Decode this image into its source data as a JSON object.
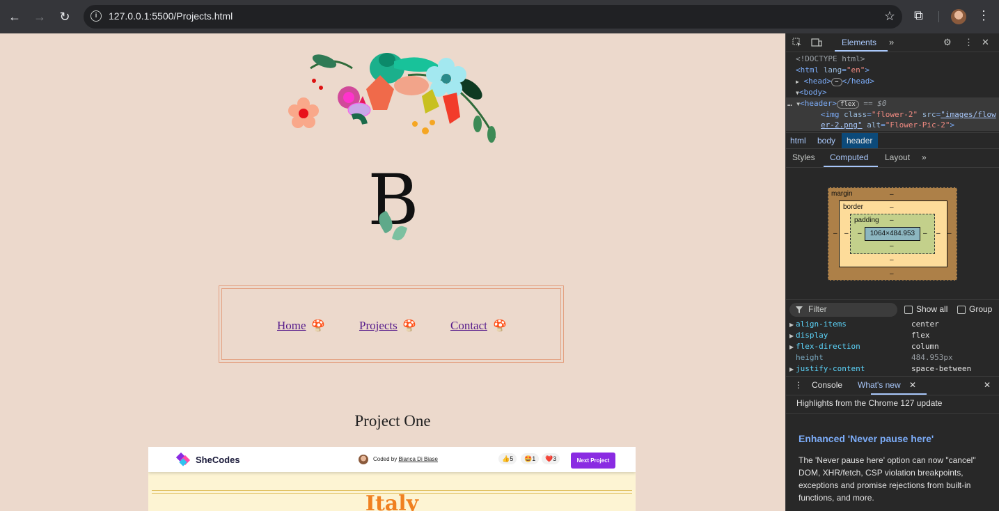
{
  "browser": {
    "url": "127.0.0.1:5500/Projects.html",
    "back_icon": "←",
    "forward_icon": "→",
    "reload_icon": "↻",
    "star_icon": "☆",
    "extensions_icon": "⧉",
    "menu_icon": "⋮"
  },
  "page": {
    "logo_letter": "B",
    "nav": [
      {
        "label": "Home",
        "emoji": "🍄"
      },
      {
        "label": "Projects",
        "emoji": "🍄"
      },
      {
        "label": "Contact",
        "emoji": "🍄"
      }
    ],
    "project_title": "Project One",
    "shecodes": {
      "brand": "SheCodes",
      "coded_by_prefix": "Coded by",
      "coder_name": "Bianca Di Biase",
      "reactions": [
        {
          "emoji": "👍",
          "count": "5"
        },
        {
          "emoji": "🤩",
          "count": "1"
        },
        {
          "emoji": "❤️",
          "count": "3"
        }
      ],
      "next_button": "Next Project"
    },
    "embedded_heading": "Italy"
  },
  "devtools": {
    "elements_tab": "Elements",
    "more_tabs": "»",
    "dom": {
      "doctype": "<!DOCTYPE html>",
      "html_open": "<html",
      "html_attr": "lang",
      "html_val": "\"en\"",
      "head": "<head>",
      "head_ellipsis": "⋯",
      "head_close": "</head>",
      "body": "<body>",
      "header": "<header>",
      "flex_pill": "flex",
      "selected_marker": "== $0",
      "img_tag": "<img",
      "img_class_attr": "class",
      "img_class_val": "\"flower-2\"",
      "img_src_attr": "src",
      "img_src_val_1": "\"images/flow",
      "img_src_val_2": "er-2.png\"",
      "img_alt_attr": "alt",
      "img_alt_val": "\"Flower-Pic-2\"",
      "img_close": ">"
    },
    "breadcrumbs": [
      "html",
      "body",
      "header"
    ],
    "subtabs": [
      "Styles",
      "Computed",
      "Layout"
    ],
    "box_model": {
      "margin_label": "margin",
      "border_label": "border",
      "padding_label": "padding",
      "content_size": "1064×484.953",
      "dash": "–"
    },
    "filter": {
      "placeholder": "Filter",
      "show_all": "Show all",
      "group": "Group"
    },
    "computed": [
      {
        "prop": "align-items",
        "value": "center",
        "dim": false
      },
      {
        "prop": "display",
        "value": "flex",
        "dim": false
      },
      {
        "prop": "flex-direction",
        "value": "column",
        "dim": false
      },
      {
        "prop": "height",
        "value": "484.953px",
        "dim": true
      },
      {
        "prop": "justify-content",
        "value": "space-between",
        "dim": false
      }
    ],
    "drawer": {
      "console": "Console",
      "whats_new": "What's new",
      "highlights": "Highlights from the Chrome 127 update",
      "feature_title": "Enhanced 'Never pause here'",
      "feature_body": "The 'Never pause here' option can now \"cancel\" DOM, XHR/fetch, CSP violation breakpoints, exceptions and promise rejections from built-in functions, and more."
    }
  }
}
